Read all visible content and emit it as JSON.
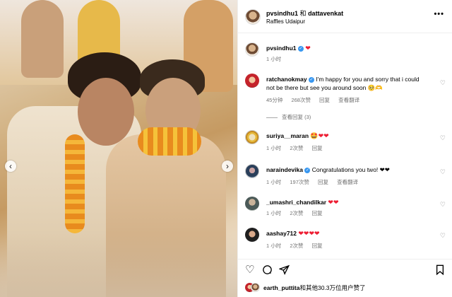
{
  "post": {
    "author": "pvsindhu1",
    "joiner": "和",
    "coauthor": "dattavenkat",
    "location": "Raffles Udaipur",
    "more_label": "•••",
    "carousel": {
      "prev_glyph": "‹",
      "next_glyph": "›"
    }
  },
  "caption": {
    "user": "pvsindhu1",
    "text": "❤",
    "time": "1 小时"
  },
  "comments": [
    {
      "user": "ratchanokmay",
      "verified": true,
      "text": "I'm happy for you and sorry that i could not be there but see you around soon 🥺🫶",
      "time": "45分钟",
      "likes": "268次赞",
      "reply": "回复",
      "translate": "查看翻译",
      "view_replies": "查看回复 (3)"
    },
    {
      "user": "suriya__maran",
      "verified": false,
      "text": "🤩❤❤",
      "time": "1 小时",
      "likes": "2次赞",
      "reply": "回复"
    },
    {
      "user": "naraindevika",
      "verified": true,
      "text": "Congratulations you two! ❤❤",
      "time": "1 小时",
      "likes": "197次赞",
      "reply": "回复",
      "translate": "查看翻译"
    },
    {
      "user": "_umashri_chandilkar",
      "verified": false,
      "text": "❤❤",
      "time": "1 小时",
      "likes": "2次赞",
      "reply": "回复"
    },
    {
      "user": "aashay712",
      "verified": false,
      "text": "❤❤❤❤",
      "time": "1 小时",
      "likes": "2次赞",
      "reply": "回复"
    }
  ],
  "actions": {
    "like_icon": "heart-outline",
    "comment_icon": "comment-bubble",
    "share_icon": "paper-plane",
    "save_icon": "bookmark"
  },
  "likes_summary": {
    "user": "earth_puttita",
    "text": "和其他30.3万位用户赞了"
  },
  "colors": {
    "heart": "#ed1d32",
    "verified": "#3897f0",
    "meta": "#737373"
  }
}
